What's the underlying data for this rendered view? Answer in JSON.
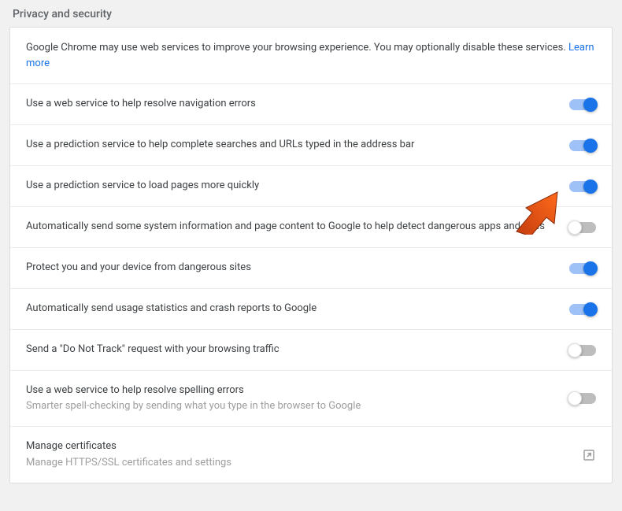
{
  "header": {
    "title": "Privacy and security"
  },
  "intro": {
    "text": "Google Chrome may use web services to improve your browsing experience. You may optionally disable these services. ",
    "link": "Learn more"
  },
  "settings": [
    {
      "label": "Use a web service to help resolve navigation errors",
      "sub": "",
      "on": true
    },
    {
      "label": "Use a prediction service to help complete searches and URLs typed in the address bar",
      "sub": "",
      "on": true
    },
    {
      "label": "Use a prediction service to load pages more quickly",
      "sub": "",
      "on": true
    },
    {
      "label": "Automatically send some system information and page content to Google to help detect dangerous apps and sites",
      "sub": "",
      "on": false
    },
    {
      "label": "Protect you and your device from dangerous sites",
      "sub": "",
      "on": true
    },
    {
      "label": "Automatically send usage statistics and crash reports to Google",
      "sub": "",
      "on": true
    },
    {
      "label": "Send a \"Do Not Track\" request with your browsing traffic",
      "sub": "",
      "on": false
    },
    {
      "label": "Use a web service to help resolve spelling errors",
      "sub": "Smarter spell-checking by sending what you type in the browser to Google",
      "on": false
    }
  ],
  "manage": {
    "label": "Manage certificates",
    "sub": "Manage HTTPS/SSL certificates and settings"
  }
}
